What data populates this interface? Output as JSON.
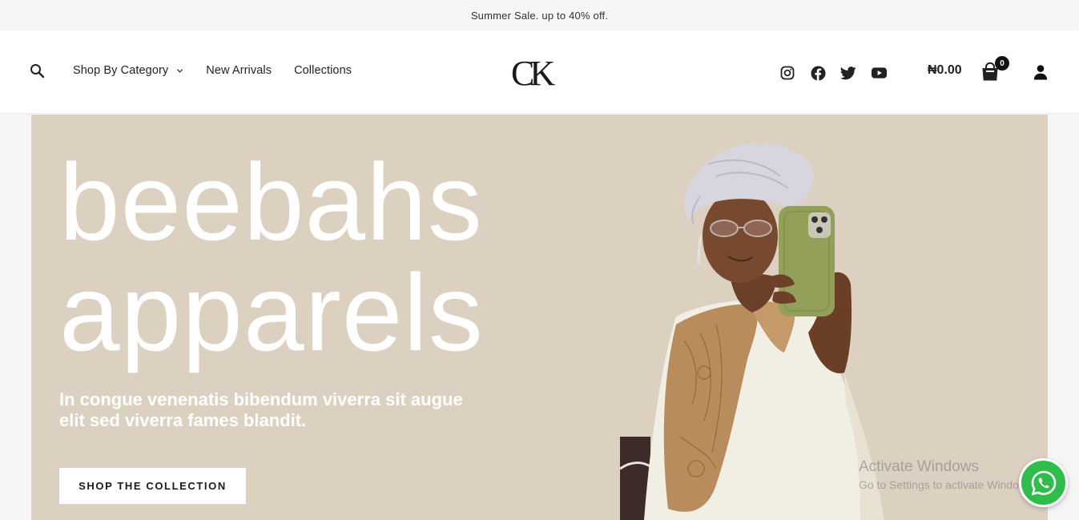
{
  "announcement": {
    "text": "Summer Sale. up to 40% off."
  },
  "header": {
    "search_icon": "search-icon",
    "nav": [
      {
        "label": "Shop By Category",
        "has_dropdown": true
      },
      {
        "label": "New Arrivals",
        "has_dropdown": false
      },
      {
        "label": "Collections",
        "has_dropdown": false
      }
    ],
    "logo_text": "CK",
    "social": [
      "instagram-icon",
      "facebook-icon",
      "twitter-icon",
      "youtube-icon"
    ],
    "cart": {
      "total": "₦0.00",
      "count": "0"
    },
    "account_icon": "user-icon"
  },
  "hero": {
    "title_line1": "beebahs",
    "title_line2": "apparels",
    "subtitle": "In congue venenatis bibendum viverra sit augue elit sed viverra fames blandit.",
    "cta_label": "SHOP THE COLLECTION",
    "background": "#dcd1c1"
  },
  "overlay": {
    "watermark_title": "Activate Windows",
    "watermark_sub": "Go to Settings to activate Windows.",
    "whatsapp_icon": "whatsapp-icon",
    "whatsapp_color": "#2fbd4b"
  }
}
